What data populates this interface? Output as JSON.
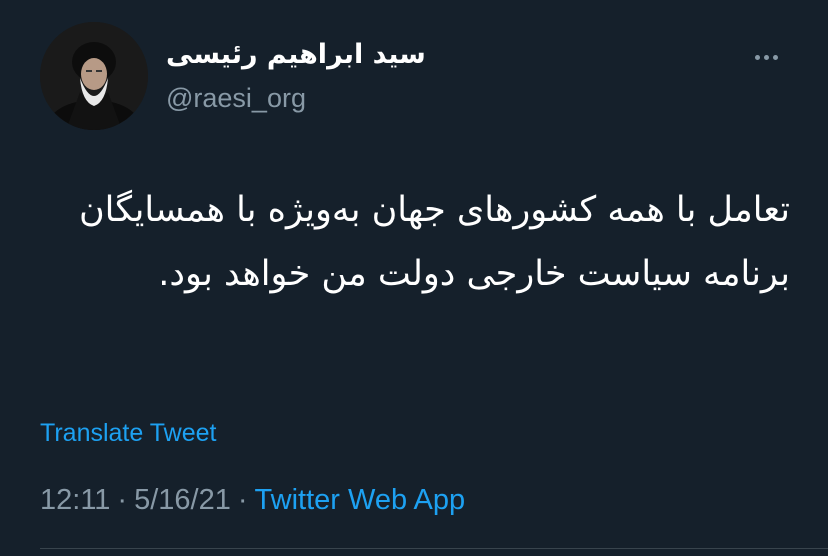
{
  "author": {
    "display_name": "سید ابراهیم رئیسی",
    "handle": "@raesi_org",
    "avatar": "avatar-portrait"
  },
  "more_icon": "more-horizontal-icon",
  "tweet": {
    "text": "تعامل با همه کشورهای جهان به‌ویژه با همسایگان برنامه سیاست خارجی دولت من خواهد بود."
  },
  "translate_label": "Translate Tweet",
  "meta": {
    "time": "12:11",
    "separator": "·",
    "date": "5/16/21",
    "source": "Twitter Web App"
  },
  "colors": {
    "background": "#15202b",
    "text": "#ffffff",
    "muted": "#8899a6",
    "accent": "#1da1f2"
  }
}
